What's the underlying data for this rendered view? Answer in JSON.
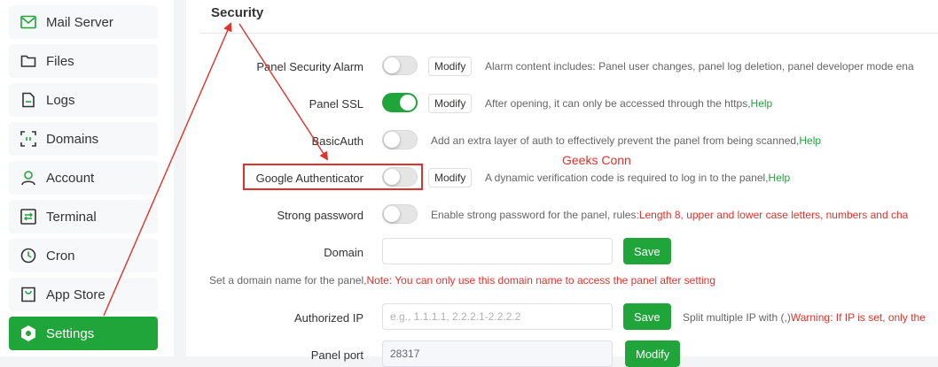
{
  "sidebar": {
    "items": [
      {
        "label": "Mail Server",
        "icon": "mail-icon"
      },
      {
        "label": "Files",
        "icon": "folder-icon"
      },
      {
        "label": "Logs",
        "icon": "document-icon"
      },
      {
        "label": "Domains",
        "icon": "domains-icon"
      },
      {
        "label": "Account",
        "icon": "user-icon"
      },
      {
        "label": "Terminal",
        "icon": "terminal-icon"
      },
      {
        "label": "Cron",
        "icon": "clock-icon"
      },
      {
        "label": "App Store",
        "icon": "store-icon"
      },
      {
        "label": "Settings",
        "icon": "settings-icon",
        "active": true
      }
    ]
  },
  "main": {
    "title": "Security",
    "rows": {
      "panel_security_alarm": {
        "label": "Panel Security Alarm",
        "toggle_on": false,
        "modify": "Modify",
        "desc": "Alarm content includes: Panel user changes, panel log deletion, panel developer mode ena"
      },
      "panel_ssl": {
        "label": "Panel SSL",
        "toggle_on": true,
        "modify": "Modify",
        "desc": "After opening, it can only be accessed through the https,",
        "help": "Help"
      },
      "basic_auth": {
        "label": "BasicAuth",
        "toggle_on": false,
        "desc": "Add an extra layer of auth to effectively prevent the panel from being scanned,",
        "help": "Help"
      },
      "google_authenticator": {
        "label": "Google Authenticator",
        "toggle_on": false,
        "modify": "Modify",
        "desc": "A dynamic verification code is required to log in to the panel,",
        "help": "Help"
      },
      "strong_password": {
        "label": "Strong password",
        "toggle_on": false,
        "desc": "Enable strong password for the panel, rules:",
        "rule": "Length 8, upper and lower case letters, numbers and cha"
      },
      "domain": {
        "label": "Domain",
        "value": "",
        "placeholder": "",
        "save": "Save",
        "note_prefix": "Set a domain name for the panel,",
        "note_warn": "Note: You can only use this domain name to access the panel after setting"
      },
      "authorized_ip": {
        "label": "Authorized IP",
        "placeholder": "e.g., 1.1.1.1, 2.2.2.1-2.2.2.2",
        "save": "Save",
        "desc": "Split multiple IP with (,)",
        "warn": "Warning: If IP is set, only the"
      },
      "panel_port": {
        "label": "Panel port",
        "value": "28317",
        "modify": "Modify"
      }
    }
  },
  "annotation": {
    "text": "Geeks Conn",
    "color": "#e0322b"
  },
  "colors": {
    "accent": "#20a53a",
    "warning": "#e0322b"
  }
}
